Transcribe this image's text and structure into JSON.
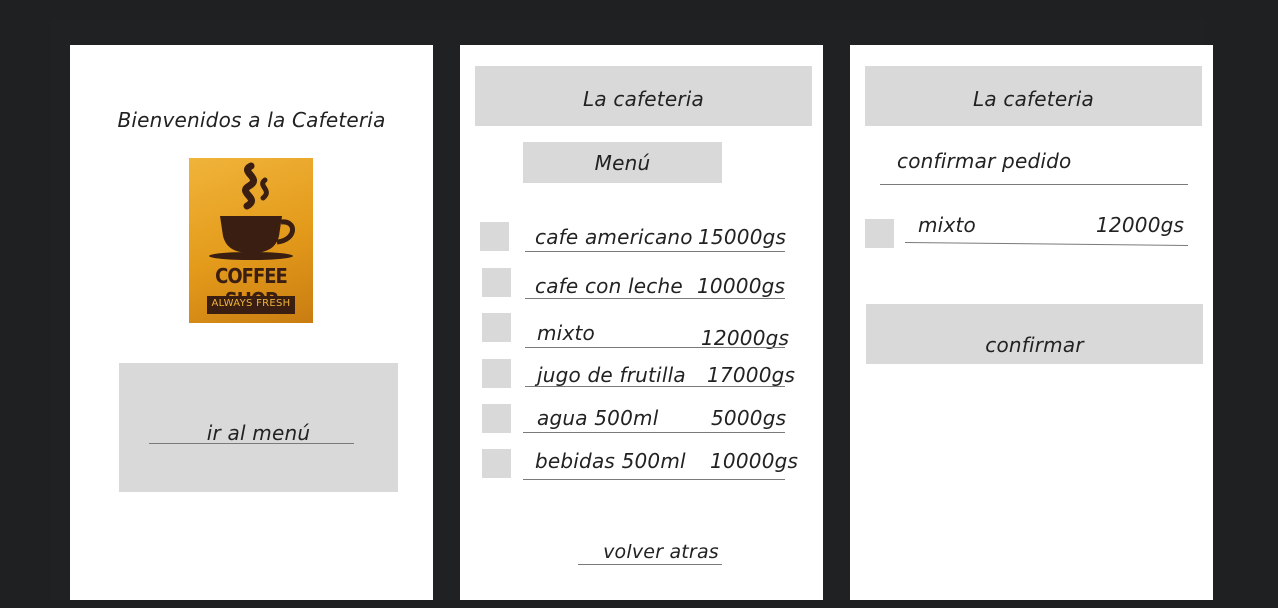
{
  "welcome": {
    "title": "Bienvenidos a la  Cafeteria",
    "logo": {
      "line1": "COFFEE SHOP",
      "line2": "ALWAYS FRESH",
      "accent": "#e6a021",
      "dark": "#3a1e12"
    },
    "menu_button_label": "ir al menú"
  },
  "menu": {
    "header": "La cafeteria",
    "section_title": "Menú",
    "items": [
      {
        "name": "cafe americano",
        "price": "15000gs"
      },
      {
        "name": "cafe con leche",
        "price": "10000gs"
      },
      {
        "name": "mixto",
        "price": "12000gs"
      },
      {
        "name": "jugo de frutilla",
        "price": "17000gs"
      },
      {
        "name": "agua 500ml",
        "price": "5000gs"
      },
      {
        "name": "bebidas 500ml",
        "price": "10000gs"
      }
    ],
    "back_label": "volver atras"
  },
  "confirm": {
    "header": "La cafeteria",
    "subtitle": "confirmar pedido",
    "item": {
      "name": "mixto",
      "price": "12000gs"
    },
    "confirm_label": "confirmar"
  },
  "colors": {
    "background": "#1f2021",
    "frame": "#ffffff",
    "block": "#d9d9d9"
  }
}
